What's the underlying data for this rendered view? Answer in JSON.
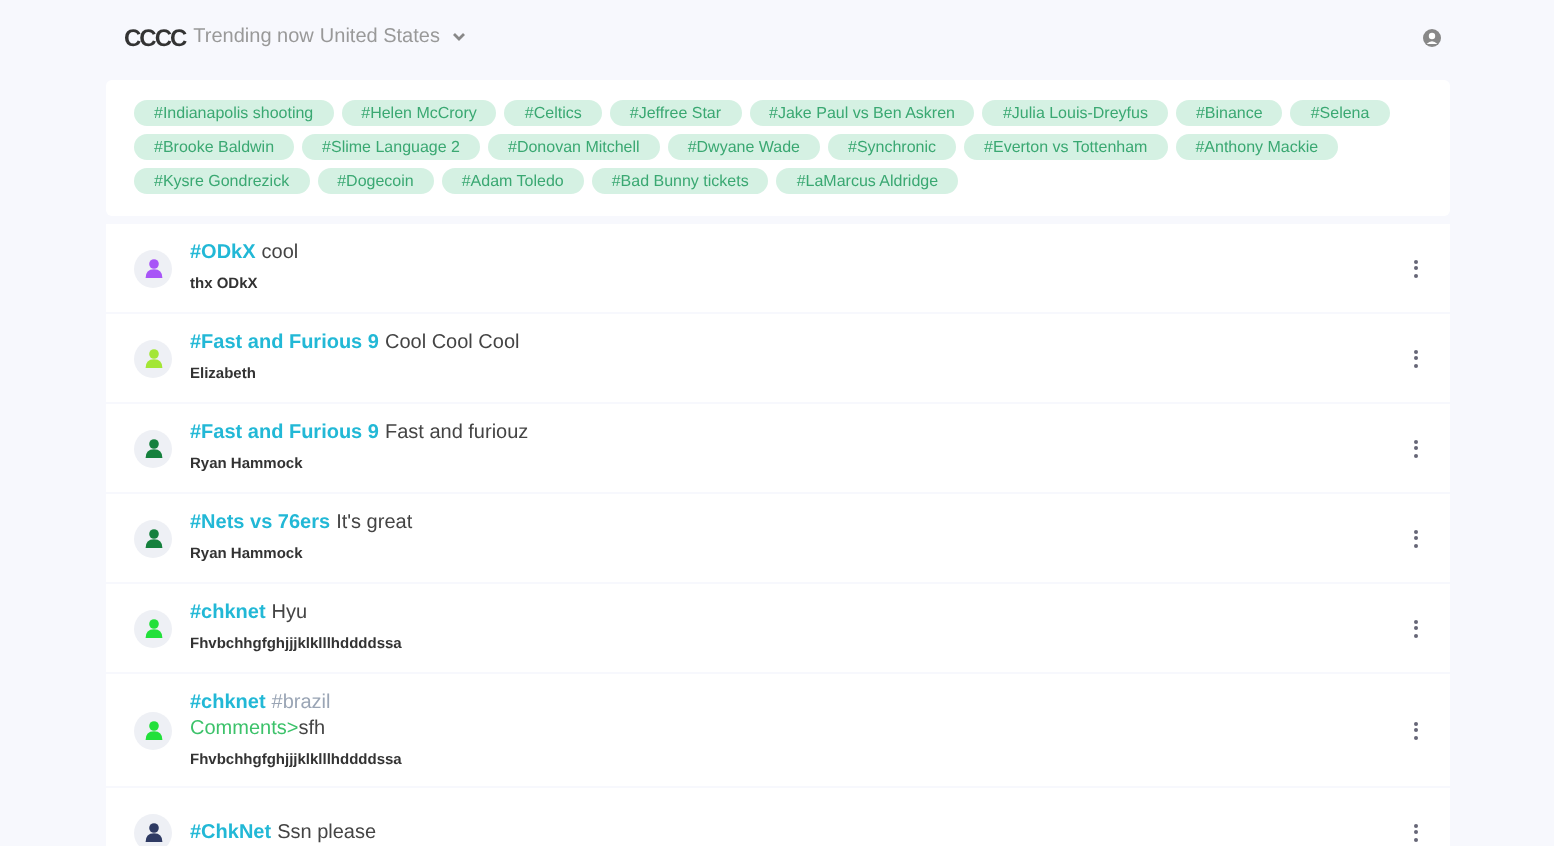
{
  "header": {
    "logo": "CCCC",
    "title": "Trending now",
    "region": "United States"
  },
  "trends": [
    "#Indianapolis shooting",
    "#Helen McCrory",
    "#Celtics",
    "#Jeffree Star",
    "#Jake Paul vs Ben Askren",
    "#Julia Louis-Dreyfus",
    "#Binance",
    "#Selena",
    "#Brooke Baldwin",
    "#Slime Language 2",
    "#Donovan Mitchell",
    "#Dwyane Wade",
    "#Synchronic",
    "#Everton vs Tottenham",
    "#Anthony Mackie",
    "#Kysre Gondrezick",
    "#Dogecoin",
    "#Adam Toledo",
    "#Bad Bunny tickets",
    "#LaMarcus Aldridge"
  ],
  "posts": [
    {
      "tags": [
        {
          "text": "#ODkX",
          "kind": "link"
        }
      ],
      "text": "cool",
      "author": "thx ODkX",
      "color": "#a855f7"
    },
    {
      "tags": [
        {
          "text": "#Fast and Furious 9",
          "kind": "link"
        }
      ],
      "text": "Cool Cool Cool",
      "author": "Elizabeth",
      "color": "#a3e635"
    },
    {
      "tags": [
        {
          "text": "#Fast and Furious 9",
          "kind": "link"
        }
      ],
      "text": "Fast and furiouz",
      "author": "Ryan Hammock",
      "color": "#15803d"
    },
    {
      "tags": [
        {
          "text": "#Nets vs 76ers",
          "kind": "link"
        }
      ],
      "text": "It's great",
      "author": "Ryan Hammock",
      "color": "#15803d"
    },
    {
      "tags": [
        {
          "text": "#chknet",
          "kind": "link"
        }
      ],
      "text": "Hyu",
      "author": "Fhvbchhgfghjjjklklllhddddssa",
      "color": "#22e03a"
    },
    {
      "tags": [
        {
          "text": "#chknet",
          "kind": "link"
        },
        {
          "text": "#brazil",
          "kind": "muted"
        }
      ],
      "comment_label": "Comments>",
      "text": "sfh",
      "author": "Fhvbchhgfghjjjklklllhddddssa",
      "color": "#22e03a"
    },
    {
      "tags": [
        {
          "text": "#ChkNet",
          "kind": "link"
        }
      ],
      "text": "Ssn please",
      "color": "#2e3a63"
    }
  ]
}
